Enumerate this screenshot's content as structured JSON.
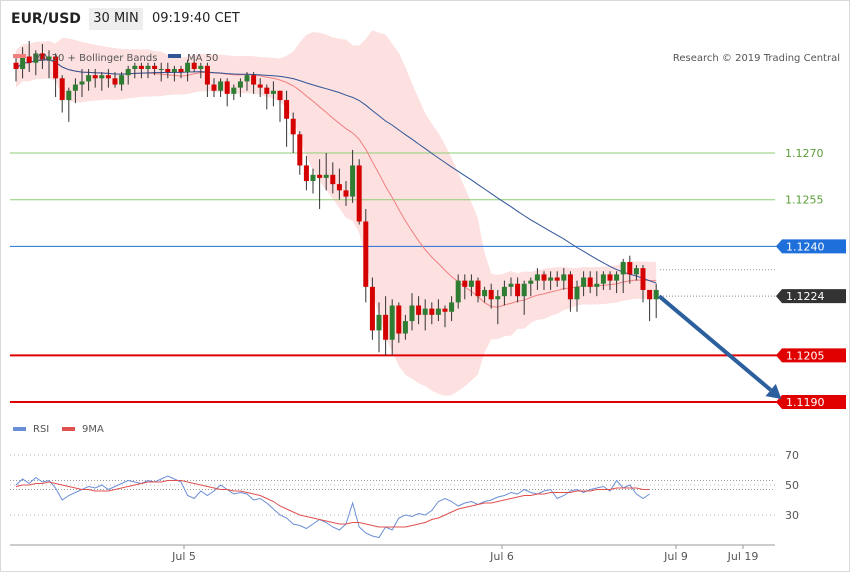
{
  "header": {
    "symbol": "EUR/USD",
    "timeframe": "30 MIN",
    "time": "09:19:40 CET"
  },
  "legend": {
    "ma20_label": "MA 20 + Bollinger Bands",
    "ma50_label": "MA 50",
    "rsi_label": "RSI",
    "ma9_label": "9MA",
    "credit": "Research © 2019 Trading Central"
  },
  "colors": {
    "bull": "#2e7d32",
    "bear": "#d50000",
    "band_fill": "#fde0e0",
    "ma20": "#f08080",
    "ma50": "#2f5597",
    "green_level": "#8fce74",
    "blue_level": "#1e6fd9",
    "red_level": "#e00000",
    "dark_tag": "#333333",
    "arrow": "#2c5f9e",
    "rsi": "#6b8fd6",
    "ma9": "#e05050"
  },
  "chart_data": {
    "type": "candlestick",
    "ylim": [
      1.1187,
      1.1322
    ],
    "x_labels": [
      "Jul 5",
      "Jul 6",
      "Jul 9",
      "Jul 19"
    ],
    "levels": [
      {
        "value": 1.127,
        "label": "1.1270",
        "style": "green-line"
      },
      {
        "value": 1.1255,
        "label": "1.1255",
        "style": "green-line"
      },
      {
        "value": 1.124,
        "label": "1.1240",
        "style": "blue-tag"
      },
      {
        "value": 1.1224,
        "label": "1.1224",
        "style": "dark-tag"
      },
      {
        "value": 1.1205,
        "label": "1.1205",
        "style": "red-tag"
      },
      {
        "value": 1.119,
        "label": "1.1190",
        "style": "red-tag"
      }
    ],
    "candles": [
      [
        1.1299,
        1.1301,
        1.1293,
        1.1297
      ],
      [
        1.1297,
        1.1304,
        1.1294,
        1.1301
      ],
      [
        1.1301,
        1.1306,
        1.1296,
        1.1299
      ],
      [
        1.1299,
        1.1303,
        1.1295,
        1.1302
      ],
      [
        1.1302,
        1.1305,
        1.1297,
        1.13
      ],
      [
        1.13,
        1.1303,
        1.1294,
        1.1301
      ],
      [
        1.1301,
        1.1302,
        1.1288,
        1.1294
      ],
      [
        1.1294,
        1.1295,
        1.1283,
        1.1287
      ],
      [
        1.1287,
        1.1291,
        1.128,
        1.129
      ],
      [
        1.129,
        1.1294,
        1.1286,
        1.1292
      ],
      [
        1.1292,
        1.1297,
        1.1288,
        1.1293
      ],
      [
        1.1293,
        1.1297,
        1.129,
        1.1295
      ],
      [
        1.1295,
        1.1297,
        1.1291,
        1.1294
      ],
      [
        1.1294,
        1.1296,
        1.129,
        1.1295
      ],
      [
        1.1295,
        1.1297,
        1.1291,
        1.1294
      ],
      [
        1.1294,
        1.1296,
        1.1291,
        1.1292
      ],
      [
        1.1292,
        1.1296,
        1.129,
        1.1295
      ],
      [
        1.1295,
        1.1298,
        1.1292,
        1.1297
      ],
      [
        1.1297,
        1.1299,
        1.1294,
        1.1298
      ],
      [
        1.1298,
        1.1299,
        1.1294,
        1.1297
      ],
      [
        1.1297,
        1.1299,
        1.1294,
        1.1298
      ],
      [
        1.1298,
        1.1299,
        1.1295,
        1.1297
      ],
      [
        1.1297,
        1.1299,
        1.1293,
        1.1297
      ],
      [
        1.1297,
        1.1299,
        1.1294,
        1.1296
      ],
      [
        1.1296,
        1.1298,
        1.1293,
        1.1297
      ],
      [
        1.1297,
        1.1298,
        1.1294,
        1.1296
      ],
      [
        1.1296,
        1.13,
        1.1293,
        1.1299
      ],
      [
        1.1299,
        1.1301,
        1.1296,
        1.1297
      ],
      [
        1.1297,
        1.1299,
        1.1294,
        1.1298
      ],
      [
        1.1298,
        1.1299,
        1.1288,
        1.1292
      ],
      [
        1.1292,
        1.1294,
        1.1288,
        1.129
      ],
      [
        1.129,
        1.1294,
        1.1288,
        1.1293
      ],
      [
        1.1293,
        1.1294,
        1.1285,
        1.1289
      ],
      [
        1.1289,
        1.1292,
        1.1287,
        1.1291
      ],
      [
        1.1291,
        1.1294,
        1.1288,
        1.1293
      ],
      [
        1.1293,
        1.1296,
        1.129,
        1.1295
      ],
      [
        1.1295,
        1.1296,
        1.1289,
        1.1292
      ],
      [
        1.1292,
        1.1294,
        1.1288,
        1.1291
      ],
      [
        1.1291,
        1.1292,
        1.1284,
        1.1289
      ],
      [
        1.1289,
        1.1293,
        1.1285,
        1.129
      ],
      [
        1.129,
        1.129,
        1.128,
        1.1287
      ],
      [
        1.1287,
        1.129,
        1.1272,
        1.1281
      ],
      [
        1.1281,
        1.1283,
        1.127,
        1.1276
      ],
      [
        1.1276,
        1.1277,
        1.1263,
        1.1266
      ],
      [
        1.1266,
        1.1269,
        1.1258,
        1.1261
      ],
      [
        1.1261,
        1.1265,
        1.1257,
        1.1263
      ],
      [
        1.1263,
        1.1268,
        1.1252,
        1.1262
      ],
      [
        1.1262,
        1.127,
        1.1258,
        1.1263
      ],
      [
        1.1263,
        1.1267,
        1.1257,
        1.126
      ],
      [
        1.126,
        1.1265,
        1.1255,
        1.1258
      ],
      [
        1.1258,
        1.1261,
        1.1253,
        1.1256
      ],
      [
        1.1256,
        1.1271,
        1.1254,
        1.1266
      ],
      [
        1.1266,
        1.1268,
        1.1247,
        1.1248
      ],
      [
        1.1248,
        1.1252,
        1.1222,
        1.1227
      ],
      [
        1.1227,
        1.123,
        1.121,
        1.1213
      ],
      [
        1.1213,
        1.1222,
        1.1206,
        1.1218
      ],
      [
        1.1218,
        1.1224,
        1.1205,
        1.121
      ],
      [
        1.121,
        1.1223,
        1.1205,
        1.1221
      ],
      [
        1.1221,
        1.1222,
        1.1209,
        1.1212
      ],
      [
        1.1212,
        1.1218,
        1.121,
        1.1216
      ],
      [
        1.1216,
        1.1225,
        1.1213,
        1.1221
      ],
      [
        1.1221,
        1.1224,
        1.1215,
        1.1218
      ],
      [
        1.1218,
        1.1223,
        1.1213,
        1.122
      ],
      [
        1.122,
        1.1222,
        1.1215,
        1.1218
      ],
      [
        1.1218,
        1.1223,
        1.1216,
        1.122
      ],
      [
        1.122,
        1.1221,
        1.1214,
        1.1219
      ],
      [
        1.1219,
        1.1224,
        1.1216,
        1.1222
      ],
      [
        1.1222,
        1.1231,
        1.122,
        1.1229
      ],
      [
        1.1229,
        1.1231,
        1.1223,
        1.1227
      ],
      [
        1.1227,
        1.1231,
        1.1224,
        1.1229
      ],
      [
        1.1229,
        1.123,
        1.1222,
        1.1224
      ],
      [
        1.1224,
        1.1227,
        1.1222,
        1.1226
      ],
      [
        1.1226,
        1.1228,
        1.122,
        1.1223
      ],
      [
        1.1223,
        1.1226,
        1.1215,
        1.1224
      ],
      [
        1.1224,
        1.1229,
        1.1221,
        1.1227
      ],
      [
        1.1227,
        1.123,
        1.1224,
        1.1228
      ],
      [
        1.1228,
        1.123,
        1.1222,
        1.1224
      ],
      [
        1.1224,
        1.1229,
        1.1218,
        1.1228
      ],
      [
        1.1228,
        1.123,
        1.1224,
        1.1229
      ],
      [
        1.1229,
        1.1233,
        1.1226,
        1.1231
      ],
      [
        1.1231,
        1.1232,
        1.1226,
        1.1229
      ],
      [
        1.1229,
        1.1232,
        1.1226,
        1.123
      ],
      [
        1.123,
        1.1232,
        1.1227,
        1.1229
      ],
      [
        1.1229,
        1.1233,
        1.1226,
        1.1231
      ],
      [
        1.1231,
        1.1232,
        1.1219,
        1.1223
      ],
      [
        1.1223,
        1.1229,
        1.1219,
        1.1227
      ],
      [
        1.1227,
        1.1232,
        1.1224,
        1.123
      ],
      [
        1.123,
        1.1232,
        1.1225,
        1.1227
      ],
      [
        1.1227,
        1.1232,
        1.1224,
        1.1228
      ],
      [
        1.1228,
        1.1232,
        1.1226,
        1.1231
      ],
      [
        1.1231,
        1.1232,
        1.1226,
        1.1229
      ],
      [
        1.1229,
        1.1232,
        1.1225,
        1.1231
      ],
      [
        1.1231,
        1.1236,
        1.1225,
        1.1235
      ],
      [
        1.1235,
        1.1237,
        1.1228,
        1.1231
      ],
      [
        1.1231,
        1.1234,
        1.1229,
        1.1233
      ],
      [
        1.1233,
        1.1234,
        1.1222,
        1.1226
      ],
      [
        1.1226,
        1.1226,
        1.1216,
        1.1223
      ],
      [
        1.1223,
        1.1228,
        1.1217,
        1.1226
      ]
    ],
    "arrow": {
      "from": [
        97,
        1.1224
      ],
      "to": [
        114,
        1.119
      ]
    },
    "rsi": {
      "ylim": [
        15,
        78
      ],
      "ticks": [
        30,
        50,
        70
      ],
      "dotted": [
        47,
        53
      ],
      "rsi_values": [
        50,
        54,
        51,
        55,
        52,
        53,
        48,
        40,
        43,
        45,
        47,
        49,
        48,
        50,
        47,
        49,
        51,
        53,
        52,
        51,
        53,
        52,
        54,
        56,
        54,
        52,
        43,
        41,
        46,
        43,
        46,
        50,
        47,
        44,
        45,
        44,
        40,
        41,
        38,
        34,
        30,
        28,
        24,
        23,
        21,
        24,
        27,
        25,
        22,
        20,
        24,
        38,
        22,
        18,
        16,
        15,
        22,
        20,
        28,
        30,
        29,
        31,
        30,
        33,
        39,
        41,
        39,
        36,
        38,
        39,
        37,
        39,
        40,
        42,
        43,
        45,
        44,
        47,
        45,
        44,
        46,
        47,
        41,
        43,
        46,
        47,
        45,
        47,
        48,
        49,
        46,
        53,
        48,
        50,
        44,
        41,
        44
      ],
      "ma9_values": [
        49,
        50,
        50,
        51,
        51,
        52,
        51,
        50,
        49,
        48,
        47,
        47,
        46,
        46,
        46,
        47,
        48,
        49,
        50,
        51,
        52,
        52,
        52,
        53,
        53,
        53,
        52,
        51,
        50,
        49,
        48,
        47,
        47,
        46,
        46,
        45,
        44,
        43,
        41,
        39,
        36,
        34,
        32,
        30,
        29,
        28,
        27,
        26,
        25,
        24,
        24,
        25,
        25,
        24,
        23,
        22,
        22,
        22,
        22,
        22,
        23,
        24,
        25,
        27,
        28,
        30,
        32,
        34,
        35,
        36,
        37,
        38,
        38,
        39,
        40,
        41,
        42,
        43,
        43,
        44,
        44,
        45,
        45,
        45,
        45,
        46,
        46,
        46,
        47,
        47,
        47,
        48,
        48,
        48,
        48,
        47,
        47
      ]
    }
  }
}
